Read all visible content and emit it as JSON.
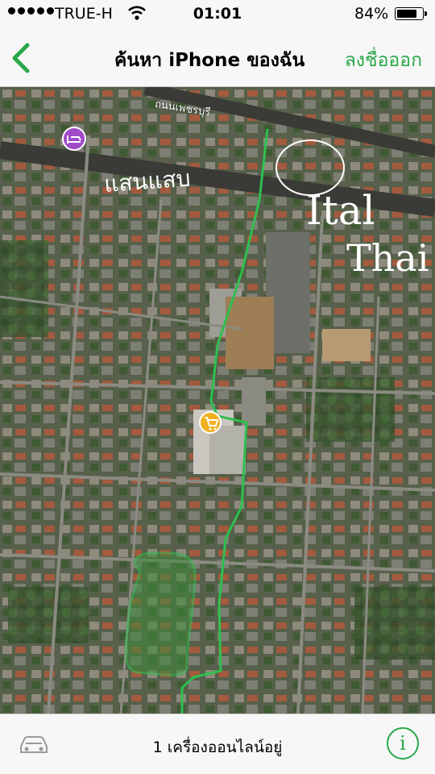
{
  "status_bar": {
    "carrier": "TRUE-H",
    "time": "01:01",
    "battery_text": "84%",
    "battery_level": 0.84
  },
  "nav": {
    "back_icon": "chevron-left-icon",
    "title": "ค้นหา iPhone ของฉัน",
    "signout_label": "ลงชื่อออก",
    "accent_color": "#2aa84a"
  },
  "map": {
    "road_label": "ถนนเพชรบุรี",
    "handwriting_left": "แสนแสบ",
    "handwriting_right_1": "Ital",
    "handwriting_right_2": "Thai",
    "hotel_icon": "bed-icon",
    "shopping_icon": "shopping-cart-icon",
    "path_color": "#2fbf4f"
  },
  "bottom_bar": {
    "car_icon": "car-icon",
    "status_text": "1 เครื่องออนไลน์อยู่",
    "info_icon": "info-icon",
    "info_glyph": "i"
  }
}
